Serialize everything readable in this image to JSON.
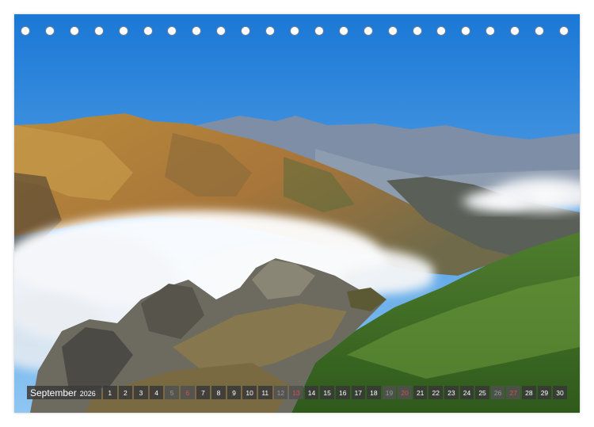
{
  "calendar": {
    "month": "September",
    "year": "2026",
    "days": [
      {
        "n": "1",
        "t": "wd"
      },
      {
        "n": "2",
        "t": "wd"
      },
      {
        "n": "3",
        "t": "wd"
      },
      {
        "n": "4",
        "t": "wd"
      },
      {
        "n": "5",
        "t": "sat"
      },
      {
        "n": "6",
        "t": "sun"
      },
      {
        "n": "7",
        "t": "wd"
      },
      {
        "n": "8",
        "t": "wd"
      },
      {
        "n": "9",
        "t": "wd"
      },
      {
        "n": "10",
        "t": "wd"
      },
      {
        "n": "11",
        "t": "wd"
      },
      {
        "n": "12",
        "t": "sat"
      },
      {
        "n": "13",
        "t": "sun"
      },
      {
        "n": "14",
        "t": "wd"
      },
      {
        "n": "15",
        "t": "wd"
      },
      {
        "n": "16",
        "t": "wd"
      },
      {
        "n": "17",
        "t": "wd"
      },
      {
        "n": "18",
        "t": "wd"
      },
      {
        "n": "19",
        "t": "sat"
      },
      {
        "n": "20",
        "t": "sun"
      },
      {
        "n": "21",
        "t": "wd"
      },
      {
        "n": "22",
        "t": "wd"
      },
      {
        "n": "23",
        "t": "wd"
      },
      {
        "n": "24",
        "t": "wd"
      },
      {
        "n": "25",
        "t": "wd"
      },
      {
        "n": "26",
        "t": "sat"
      },
      {
        "n": "27",
        "t": "sun"
      },
      {
        "n": "28",
        "t": "wd"
      },
      {
        "n": "29",
        "t": "wd"
      },
      {
        "n": "30",
        "t": "wd"
      }
    ]
  },
  "binding": {
    "hole_count": 23
  },
  "colors": {
    "sky_top": "#1a78d6",
    "sky_bottom": "#8ec6f2",
    "sunday": "#e24a4a",
    "saturday": "#9a9a9a"
  }
}
